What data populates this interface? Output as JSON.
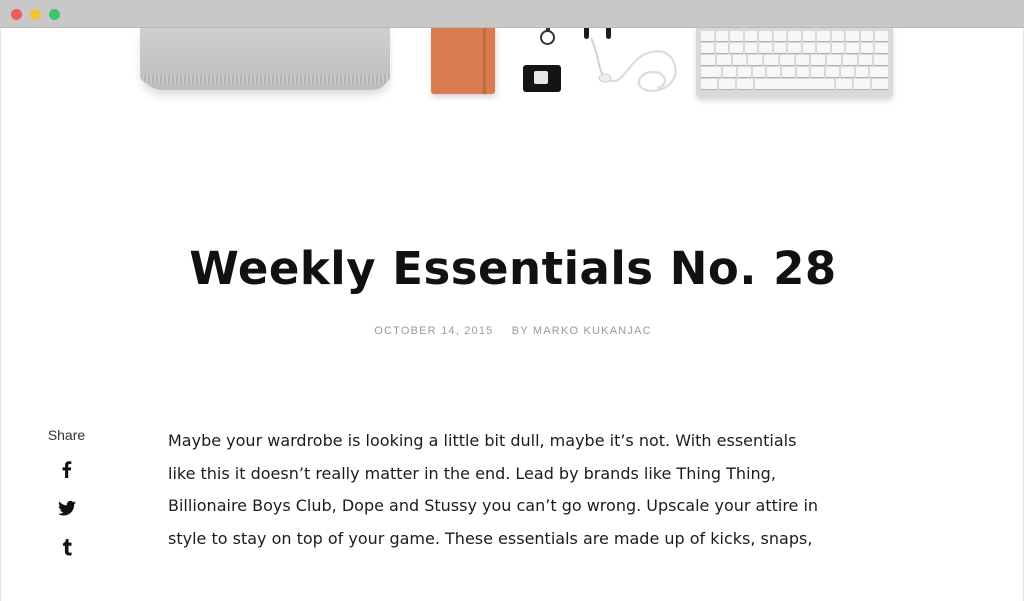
{
  "window": {
    "controls": [
      "close",
      "minimize",
      "maximize"
    ]
  },
  "hero": {
    "image": "flat-lay-essentials-photo"
  },
  "post": {
    "title": "Weekly Essentials No. 28",
    "date": "OCTOBER 14, 2015",
    "author": "BY MARKO KUKANJAC"
  },
  "share": {
    "label": "Share",
    "icons": [
      "facebook-icon",
      "twitter-icon",
      "tumblr-icon"
    ]
  },
  "article": {
    "lines": [
      "Maybe your wardrobe is looking a little bit dull, maybe it’s not. With essentials",
      "like this it doesn’t really matter in the end. Lead by brands like Thing Thing,",
      "Billionaire Boys Club, Dope and Stussy you can’t go wrong. Upscale your attire in",
      "style to stay on top of your game. These essentials are made up of kicks, snaps,"
    ]
  },
  "colors": {
    "chrome": "#c8c8c8",
    "close": "#f05b5b",
    "minimize": "#f0c23a",
    "maximize": "#3cc56b",
    "title": "#111111",
    "meta": "#9a9a9a",
    "body_text": "#1c1c1c"
  }
}
